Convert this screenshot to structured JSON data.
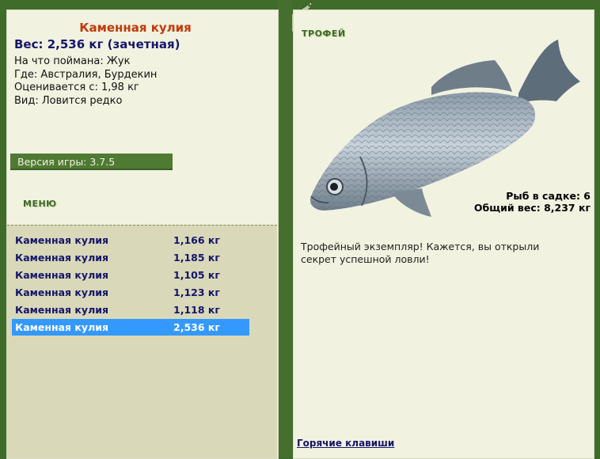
{
  "fish": {
    "name": "Каменная кулия",
    "weight_line": "Вес: 2,536 кг (зачетная)",
    "bait_line": "На что поймана: Жук",
    "place_line": "Где: Австралия, Бурдекин",
    "value_line": "Оценивается с: 1,98 кг",
    "type_line": "Вид: Ловится редко"
  },
  "version": "Версия игры: 3.7.5",
  "menu_label": "МЕНЮ",
  "cage": {
    "count_line": "Рыб в садке: 6",
    "total_line": "Общий вес: 8,237 кг"
  },
  "catches": [
    {
      "name": "Каменная кулия",
      "weight": "1,166 кг"
    },
    {
      "name": "Каменная кулия",
      "weight": "1,185 кг"
    },
    {
      "name": "Каменная кулия",
      "weight": "1,105 кг"
    },
    {
      "name": "Каменная кулия",
      "weight": "1,123 кг"
    },
    {
      "name": "Каменная кулия",
      "weight": "1,118 кг"
    },
    {
      "name": "Каменная кулия",
      "weight": "2,536 кг"
    }
  ],
  "selected_catch_index": 5,
  "trophy": {
    "label": "ТРОФЕЙ",
    "text": "Трофейный экземпляр! Кажется, вы открыли секрет успешной ловли!"
  },
  "hotkeys_link": "Горячие клавиши",
  "colors": {
    "frame_green": "#3f6b2b",
    "panel_bg": "#f2f2e1",
    "fish_name": "#c03a0a",
    "navy_text": "#15156b",
    "selected_row": "#3399ff"
  }
}
